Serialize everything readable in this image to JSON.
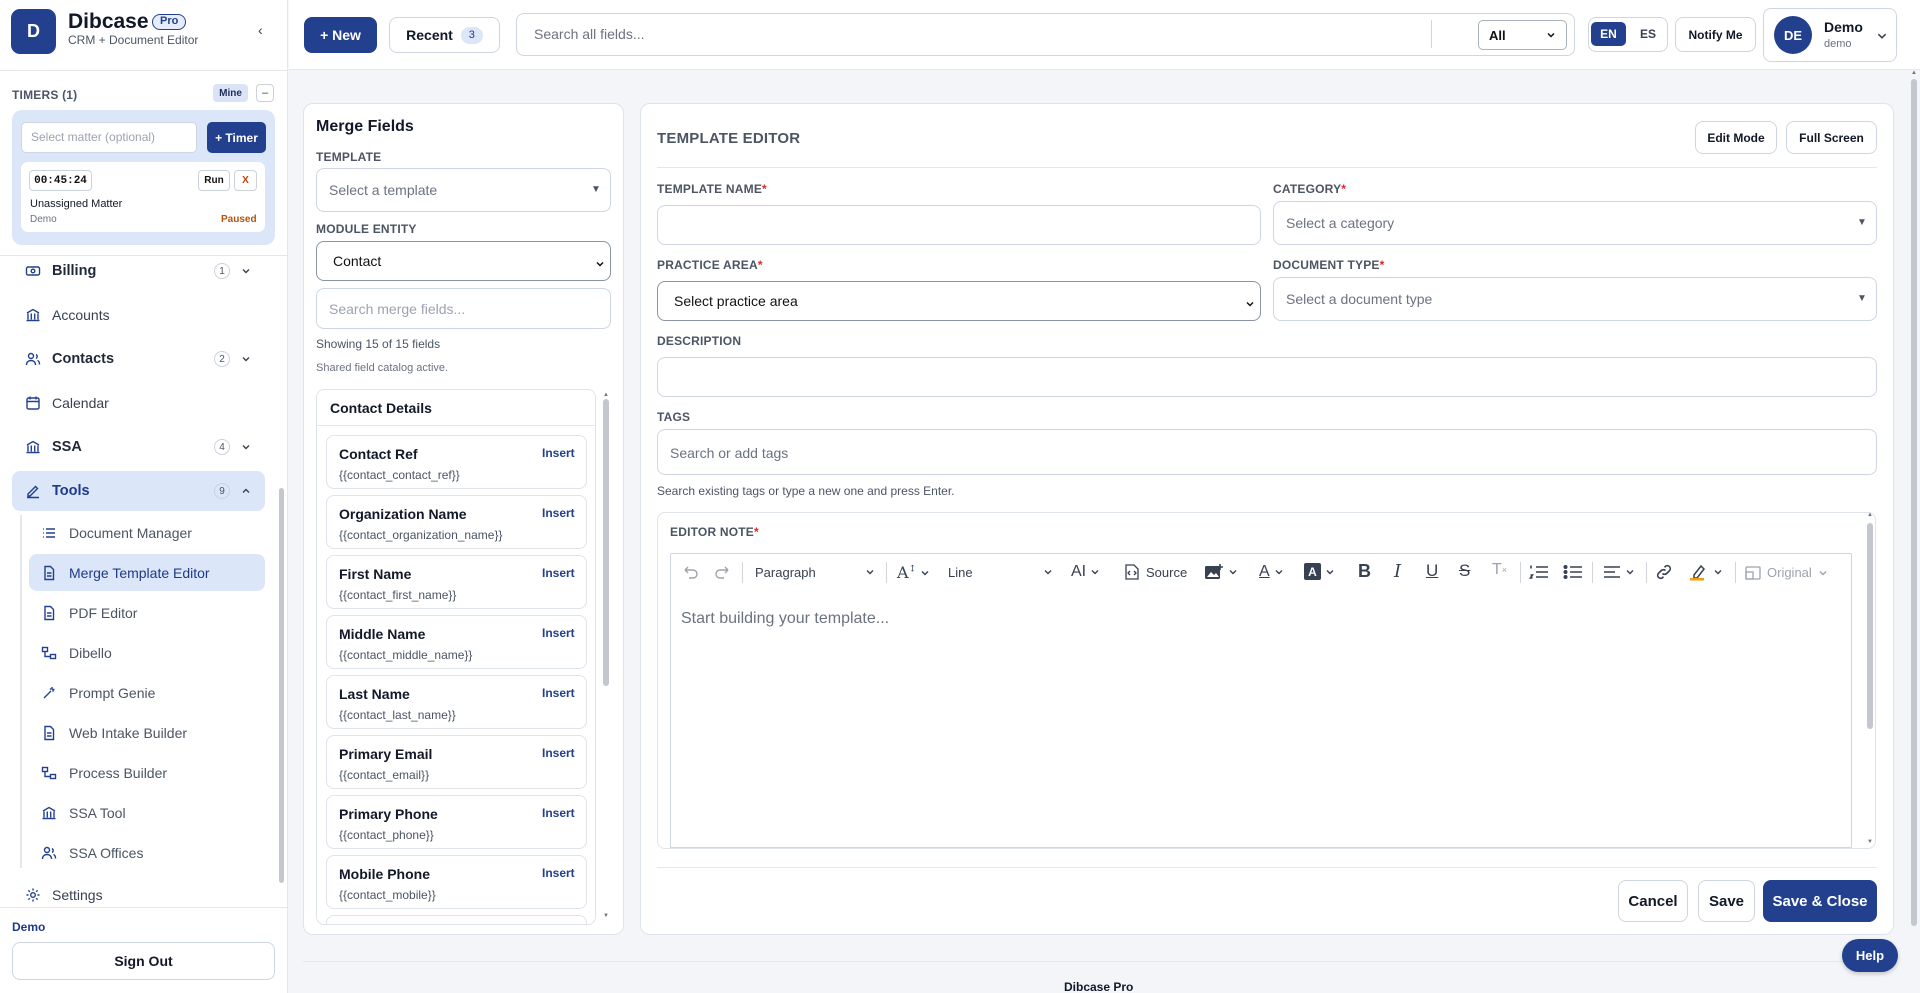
{
  "brand": {
    "logo_letter": "D",
    "name": "Dibcase",
    "badge": "Pro",
    "subtitle": "CRM + Document Editor",
    "collapse_glyph": "‹"
  },
  "timers": {
    "title": "TIMERS (1)",
    "mine_label": "Mine",
    "collapse_label": "–",
    "matter_placeholder": "Select matter (optional)",
    "add_timer_label": "+ Timer",
    "entry": {
      "time": "00:45:24",
      "run_label": "Run",
      "close_label": "X",
      "matter": "Unassigned Matter",
      "user": "Demo",
      "status": "Paused"
    }
  },
  "nav": {
    "billing": {
      "label": "Billing",
      "count": "1"
    },
    "accounts": {
      "label": "Accounts"
    },
    "contacts": {
      "label": "Contacts",
      "count": "2"
    },
    "calendar": {
      "label": "Calendar"
    },
    "ssa": {
      "label": "SSA",
      "count": "4"
    },
    "tools": {
      "label": "Tools",
      "count": "9"
    },
    "tools_items": [
      {
        "label": "Document Manager",
        "icon": "list-icon"
      },
      {
        "label": "Merge Template Editor",
        "icon": "document-icon"
      },
      {
        "label": "PDF Editor",
        "icon": "document-icon"
      },
      {
        "label": "Dibello",
        "icon": "workflow-icon"
      },
      {
        "label": "Prompt Genie",
        "icon": "wand-icon"
      },
      {
        "label": "Web Intake Builder",
        "icon": "document-icon"
      },
      {
        "label": "Process Builder",
        "icon": "workflow-icon"
      },
      {
        "label": "SSA Tool",
        "icon": "bank-icon"
      },
      {
        "label": "SSA Offices",
        "icon": "contacts-icon"
      }
    ],
    "settings": {
      "label": "Settings"
    }
  },
  "account": {
    "name": "Demo",
    "sign_out_label": "Sign Out"
  },
  "topbar": {
    "new_label": "+ New",
    "recent_label": "Recent",
    "recent_count": "3",
    "search_placeholder": "Search all fields...",
    "scope_value": "All",
    "lang_en": "EN",
    "lang_es": "ES",
    "notify_label": "Notify Me",
    "user_initials": "DE",
    "user_name": "Demo",
    "user_sub": "demo"
  },
  "merge_fields": {
    "title": "Merge Fields",
    "template_label": "TEMPLATE",
    "template_placeholder": "Select a template",
    "module_label": "MODULE ENTITY",
    "module_value": "Contact",
    "search_placeholder": "Search merge fields...",
    "showing": "Showing 15 of 15 fields",
    "catalog_note": "Shared field catalog active.",
    "group_title": "Contact Details",
    "insert_label": "Insert",
    "fields": [
      {
        "name": "Contact Ref",
        "code": "{{contact_contact_ref}}"
      },
      {
        "name": "Organization Name",
        "code": "{{contact_organization_name}}"
      },
      {
        "name": "First Name",
        "code": "{{contact_first_name}}"
      },
      {
        "name": "Middle Name",
        "code": "{{contact_middle_name}}"
      },
      {
        "name": "Last Name",
        "code": "{{contact_last_name}}"
      },
      {
        "name": "Primary Email",
        "code": "{{contact_email}}"
      },
      {
        "name": "Primary Phone",
        "code": "{{contact_phone}}"
      },
      {
        "name": "Mobile Phone",
        "code": "{{contact_mobile}}"
      }
    ]
  },
  "editor": {
    "title": "TEMPLATE EDITOR",
    "edit_mode_label": "Edit Mode",
    "full_screen_label": "Full Screen",
    "template_name_label": "TEMPLATE NAME",
    "template_name_value": "",
    "category_label": "CATEGORY",
    "category_placeholder": "Select a category",
    "practice_area_label": "PRACTICE AREA",
    "practice_area_value": "Select practice area",
    "document_type_label": "DOCUMENT TYPE",
    "document_type_placeholder": "Select a document type",
    "description_label": "DESCRIPTION",
    "description_value": "",
    "tags_label": "TAGS",
    "tags_placeholder": "Search or add tags",
    "tags_hint": "Search existing tags or type a new one and press Enter.",
    "note_label": "EDITOR NOTE",
    "required_mark": "*",
    "toolbar": {
      "paragraph": "Paragraph",
      "line": "Line",
      "source": "Source",
      "original": "Original"
    },
    "content_placeholder": "Start building your template...",
    "cancel_label": "Cancel",
    "save_label": "Save",
    "save_close_label": "Save & Close"
  },
  "help_label": "Help",
  "footer_text": "Dibcase Pro",
  "colors": {
    "primary": "#23408e",
    "active_bg": "#dbe6f9",
    "required": "#dc2626",
    "paused": "#b45309"
  }
}
